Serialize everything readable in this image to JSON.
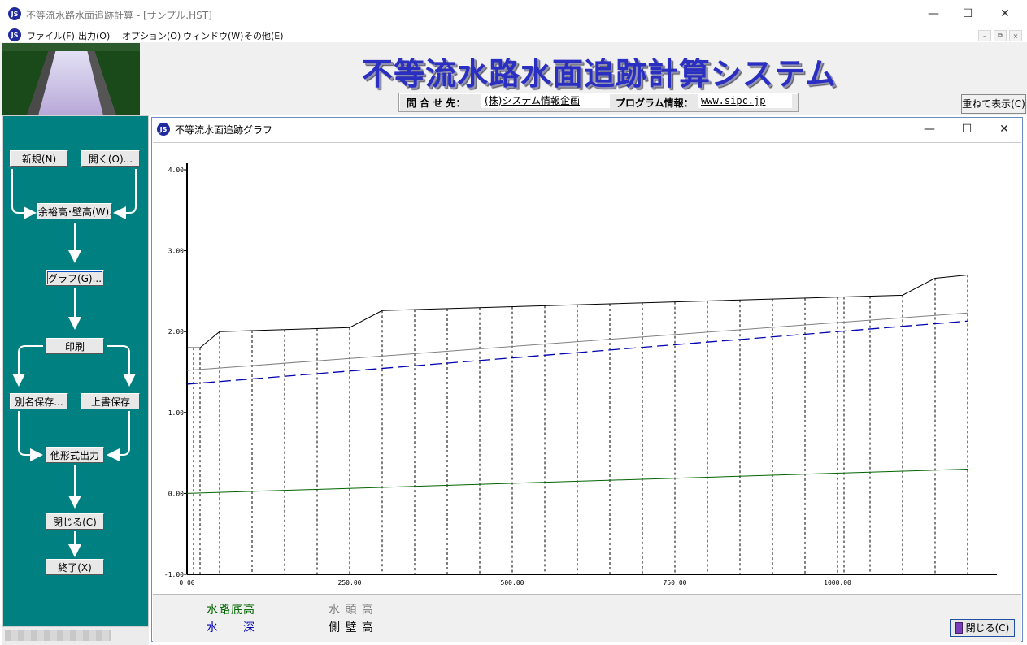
{
  "window": {
    "title": "不等流水路水面追跡計算 - [サンプル.HST]",
    "icon_text": "JS",
    "minimize": "—",
    "maximize": "☐",
    "close": "✕"
  },
  "menu": [
    "ファイル(F)",
    "出力(O)",
    "オプション(O)",
    "ウィンドウ(W)",
    "その他(E)"
  ],
  "mdi_controls": [
    "–",
    "⧉",
    "×"
  ],
  "header": {
    "title": "不等流水路水面追跡計算システム",
    "contact_label": "問 合 せ 先：",
    "contact_value": "(株)システム情報企画",
    "program_label": "プログラム情報：",
    "program_value": "www.sipc.jp",
    "stack_button": "重ねて表示(C)"
  },
  "flow": {
    "new": "新規(N)",
    "open": "開く(O)...",
    "freeboard": "余裕高･壁高(W)...",
    "graph": "グラフ(G)...",
    "print": "印刷",
    "save_as": "別名保存...",
    "overwrite": "上書保存",
    "export": "他形式出力",
    "close": "閉じる(C)",
    "exit": "終了(X)"
  },
  "graph_window": {
    "title": "不等流水面追跡グラフ",
    "minimize": "—",
    "maximize": "☐",
    "close": "✕",
    "close_button": "閉じる(C)"
  },
  "legend": {
    "bed": "水路底高",
    "head": "水 頭 高",
    "depth": "水　　深",
    "wall": "側 壁 高"
  },
  "colors": {
    "bed": "#006400",
    "head": "#808080",
    "depth": "#0000b0",
    "wall": "#000000",
    "panel": "#008080",
    "title": "#2a2fc2"
  },
  "chart_data": {
    "type": "line",
    "xlim": [
      0,
      1220
    ],
    "ylim": [
      -1,
      4
    ],
    "x_ticks": [
      "0.00",
      "250.00",
      "500.00",
      "750.00",
      "1000.00"
    ],
    "x_tick_values": [
      0,
      250,
      500,
      750,
      1000
    ],
    "y_ticks": [
      "4.00",
      "3.00",
      "2.00",
      "1.00",
      "0.00",
      "-1.00"
    ],
    "y_tick_values": [
      4,
      3,
      2,
      1,
      0,
      -1
    ],
    "section_x": [
      0,
      10,
      20,
      50,
      100,
      150,
      200,
      250,
      300,
      350,
      400,
      450,
      500,
      550,
      600,
      650,
      700,
      750,
      800,
      850,
      900,
      950,
      1000,
      1010,
      1050,
      1100,
      1150,
      1200
    ],
    "series": [
      {
        "name": "側 壁 高",
        "color": "#000000",
        "dash": "",
        "x": [
          0,
          20,
          50,
          250,
          300,
          1100,
          1150,
          1200
        ],
        "y": [
          1.8,
          1.8,
          2.0,
          2.05,
          2.26,
          2.45,
          2.66,
          2.7
        ]
      },
      {
        "name": "水 頭 高",
        "color": "#808080",
        "dash": "",
        "x": [
          0,
          1200
        ],
        "y": [
          1.52,
          2.23
        ]
      },
      {
        "name": "水　　深",
        "color": "#0000b0",
        "dash": "14 6",
        "x": [
          0,
          1200
        ],
        "y": [
          1.35,
          2.13
        ]
      },
      {
        "name": "水路底高",
        "color": "#006400",
        "dash": "",
        "x": [
          0,
          1200
        ],
        "y": [
          0.0,
          0.3
        ]
      }
    ]
  }
}
